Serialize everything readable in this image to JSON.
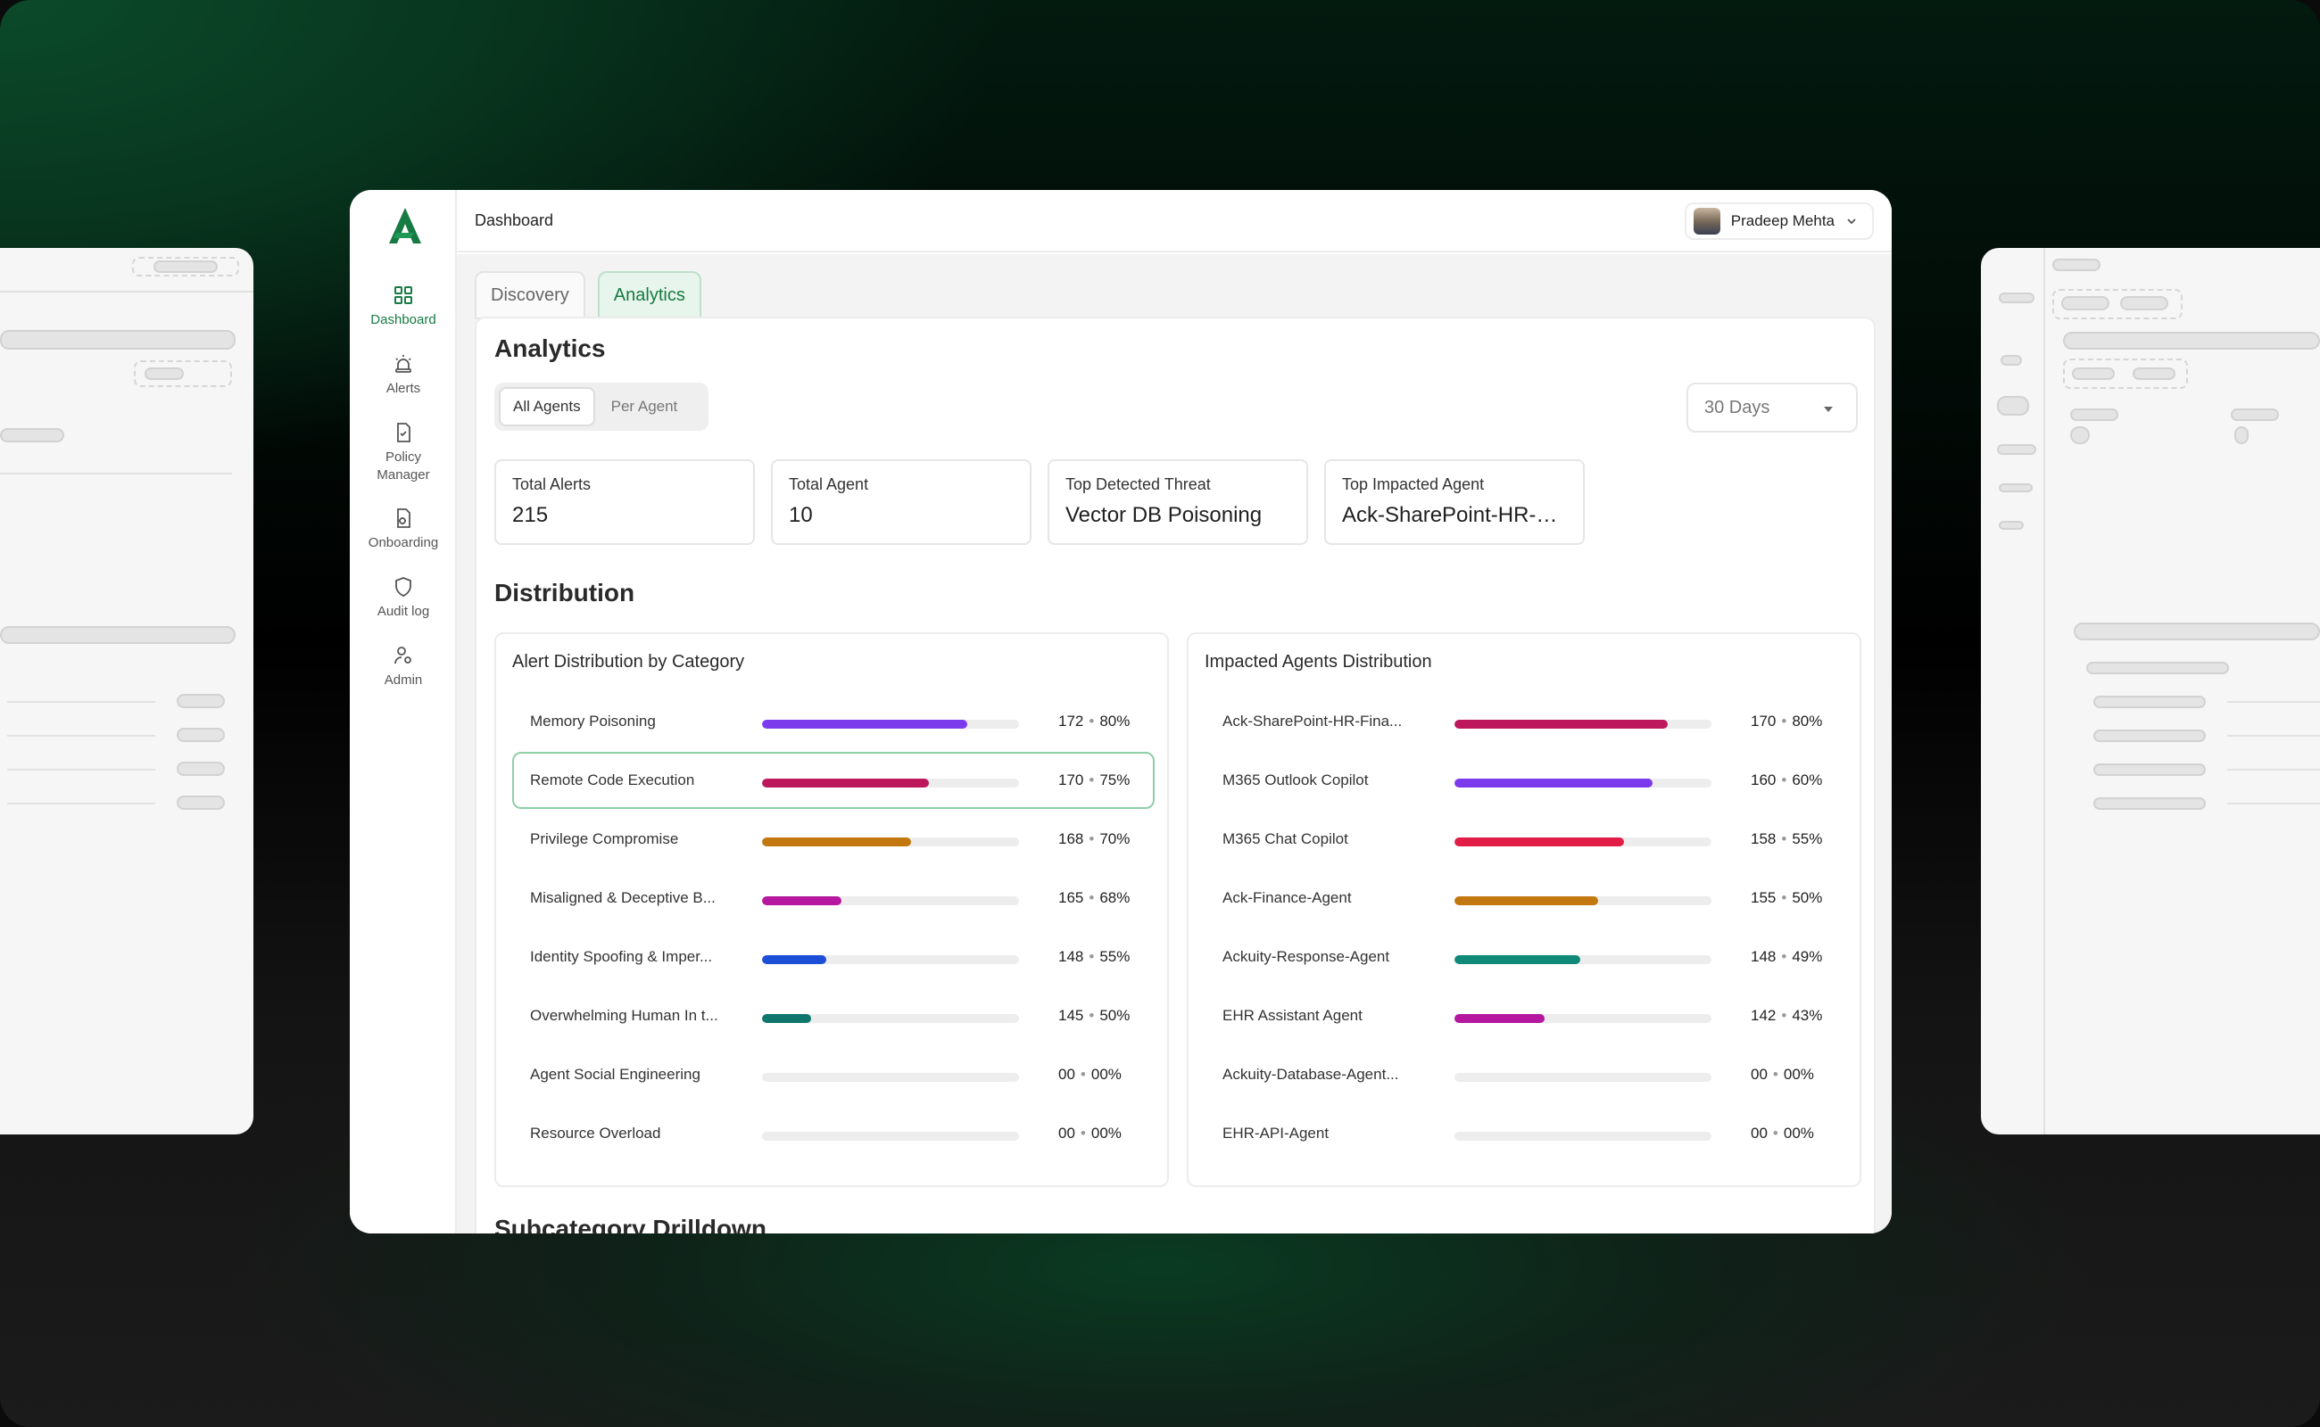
{
  "header": {
    "breadcrumb": "Dashboard",
    "user_name": "Pradeep Mehta"
  },
  "sidebar": {
    "items": [
      {
        "label": "Dashboard",
        "icon": "grid-icon",
        "active": true
      },
      {
        "label": "Alerts",
        "icon": "siren-icon"
      },
      {
        "label": "Policy Manager",
        "icon": "document-check-icon"
      },
      {
        "label": "Onboarding",
        "icon": "onboarding-icon"
      },
      {
        "label": "Audit log",
        "icon": "shield-icon"
      },
      {
        "label": "Admin",
        "icon": "user-gear-icon"
      }
    ]
  },
  "tabs": [
    {
      "label": "Discovery",
      "active": false
    },
    {
      "label": "Analytics",
      "active": true
    }
  ],
  "analytics": {
    "title": "Analytics",
    "segment": {
      "options": [
        "All Agents",
        "Per Agent"
      ],
      "selected": "All Agents"
    },
    "range_select": {
      "value": "30 Days"
    },
    "kpis": [
      {
        "label": "Total Alerts",
        "value": "215"
      },
      {
        "label": "Total Agent",
        "value": "10"
      },
      {
        "label": "Top Detected Threat",
        "value": "Vector DB Poisoning"
      },
      {
        "label": "Top Impacted Agent",
        "value": "Ack-SharePoint-HR-Fin..."
      }
    ]
  },
  "distribution": {
    "title": "Distribution",
    "category_card": {
      "title": "Alert Distribution by Category",
      "rows": [
        {
          "name": "Memory Poisoning",
          "count": "172",
          "pct": "80%",
          "value": 80,
          "color": "#7c3aed"
        },
        {
          "name": "Remote Code Execution",
          "count": "170",
          "pct": "75%",
          "value": 65,
          "color": "#be185d",
          "selected": true
        },
        {
          "name": "Privilege Compromise",
          "count": "168",
          "pct": "70%",
          "value": 58,
          "color": "#c2780f"
        },
        {
          "name": "Misaligned & Deceptive B...",
          "count": "165",
          "pct": "68%",
          "value": 31,
          "color": "#b5179e"
        },
        {
          "name": "Identity Spoofing & Imper...",
          "count": "148",
          "pct": "55%",
          "value": 25,
          "color": "#1d4ed8"
        },
        {
          "name": "Overwhelming Human In t...",
          "count": "145",
          "pct": "50%",
          "value": 19,
          "color": "#0f766e"
        },
        {
          "name": "Agent Social Engineering",
          "count": "00",
          "pct": "00%",
          "value": 0,
          "color": "#cccccc"
        },
        {
          "name": "Resource Overload",
          "count": "00",
          "pct": "00%",
          "value": 0,
          "color": "#cccccc"
        }
      ]
    },
    "agents_card": {
      "title": "Impacted Agents Distribution",
      "rows": [
        {
          "name": "Ack-SharePoint-HR-Fina...",
          "count": "170",
          "pct": "80%",
          "value": 83,
          "color": "#be185d"
        },
        {
          "name": "M365 Outlook Copilot",
          "count": "160",
          "pct": "60%",
          "value": 77,
          "color": "#7c3aed"
        },
        {
          "name": "M365 Chat Copilot",
          "count": "158",
          "pct": "55%",
          "value": 66,
          "color": "#e11d48"
        },
        {
          "name": "Ack-Finance-Agent",
          "count": "155",
          "pct": "50%",
          "value": 56,
          "color": "#c2780f"
        },
        {
          "name": "Ackuity-Response-Agent",
          "count": "148",
          "pct": "49%",
          "value": 49,
          "color": "#0f8a78"
        },
        {
          "name": "EHR Assistant Agent",
          "count": "142",
          "pct": "43%",
          "value": 35,
          "color": "#b5179e"
        },
        {
          "name": "Ackuity-Database-Agent...",
          "count": "00",
          "pct": "00%",
          "value": 0,
          "color": "#cccccc"
        },
        {
          "name": "EHR-API-Agent",
          "count": "00",
          "pct": "00%",
          "value": 0,
          "color": "#cccccc"
        }
      ]
    }
  },
  "subcategory": {
    "title": "Subcategory Drilldown"
  },
  "colors": {
    "accent": "#167a43",
    "accent_bg": "#e8f5ec"
  }
}
